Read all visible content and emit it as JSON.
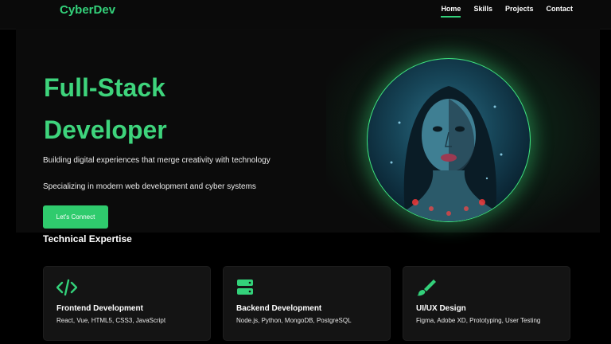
{
  "nav": {
    "logo": "CyberDev",
    "links": [
      {
        "label": "Home",
        "active": true
      },
      {
        "label": "Skills",
        "active": false
      },
      {
        "label": "Projects",
        "active": false
      },
      {
        "label": "Contact",
        "active": false
      }
    ]
  },
  "hero": {
    "title_line1": "Full-Stack",
    "title_line2": "Developer",
    "tagline": "Building digital experiences that merge creativity with technology",
    "subtitle": "Specializing in modern web development and cyber systems",
    "cta_label": "Let's Connect",
    "portrait_icon": "developer-portrait"
  },
  "skills": {
    "title": "Technical Expertise",
    "cards": [
      {
        "icon": "code-icon",
        "title": "Frontend Development",
        "desc": "React, Vue, HTML5, CSS3, JavaScript"
      },
      {
        "icon": "server-icon",
        "title": "Backend Development",
        "desc": "Node.js, Python, MongoDB, PostgreSQL"
      },
      {
        "icon": "brush-icon",
        "title": "UI/UX Design",
        "desc": "Figma, Adobe XD, Prototyping, User Testing"
      }
    ]
  },
  "colors": {
    "accent": "#33d17a",
    "background": "#000000",
    "card": "#141414"
  }
}
